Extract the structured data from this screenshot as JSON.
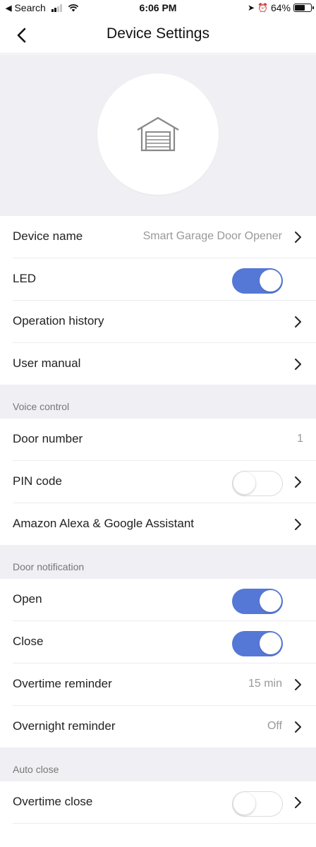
{
  "status_bar": {
    "back_arrow": "◀",
    "back_label": "Search",
    "time": "6:06 PM",
    "location_icon": "➤",
    "alarm_icon": "⏰",
    "battery_text": "64%",
    "battery_level": 0.64
  },
  "nav": {
    "title": "Device Settings"
  },
  "device": {
    "name_label": "Device name",
    "name_value": "Smart Garage Door Opener",
    "led_label": "LED",
    "led_on": true,
    "history_label": "Operation history",
    "manual_label": "User manual"
  },
  "voice_control": {
    "header": "Voice control",
    "door_number_label": "Door number",
    "door_number_value": "1",
    "pin_label": "PIN code",
    "pin_on": false,
    "assistant_label": "Amazon Alexa & Google Assistant"
  },
  "door_notification": {
    "header": "Door notification",
    "open_label": "Open",
    "open_on": true,
    "close_label": "Close",
    "close_on": true,
    "overtime_label": "Overtime reminder",
    "overtime_value": "15 min",
    "overnight_label": "Overnight reminder",
    "overnight_value": "Off"
  },
  "auto_close": {
    "header": "Auto close",
    "overtime_close_label": "Overtime close",
    "overtime_close_on": false
  },
  "colors": {
    "toggle_on": "#5578d6",
    "background_grey": "#efeff4"
  }
}
